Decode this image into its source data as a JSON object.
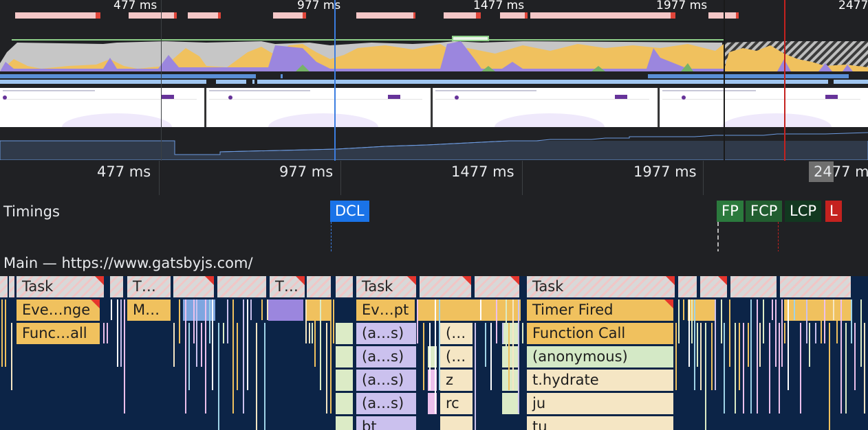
{
  "overview": {
    "time_labels": [
      "477 ms",
      "977 ms",
      "1477 ms",
      "1977 ms",
      "2477"
    ]
  },
  "ruler": {
    "time_labels": [
      "477 ms",
      "977 ms",
      "1477 ms",
      "1977 ms",
      "2477 m"
    ]
  },
  "timings": {
    "title": "Timings",
    "markers": [
      {
        "label": "DCL",
        "color": "#1a73e8"
      },
      {
        "label": "FP",
        "color": "#1e8e3e"
      },
      {
        "label": "FCP",
        "color": "#1e6b33"
      },
      {
        "label": "LCP",
        "color": "#0d3b1e"
      },
      {
        "label": "L",
        "color": "#c5221f"
      }
    ]
  },
  "main": {
    "title": "Main — https://www.gatsbyjs.com/",
    "blocks": {
      "task1": "Task",
      "task2": "T…",
      "task3": "T…",
      "task4": "Task",
      "task5": "Task",
      "event1": "Eve…nge",
      "misc1": "M…",
      "event2": "Ev…pt",
      "timer": "Timer Fired",
      "func1": "Func…all",
      "anon1": "(a…s)",
      "paren1": "(…",
      "funccall": "Function Call",
      "anon2": "(a…s)",
      "paren2": "(…",
      "anonymous": "(anonymous)",
      "anon3": "(a…s)",
      "z": "z",
      "hydrate": "t.hydrate",
      "anon4": "(a…s)",
      "rc": "rc",
      "ju": "ju",
      "bt": "bt",
      "tu": "tu"
    }
  },
  "colors": {
    "scripting": "#f0c15e",
    "rendering": "#9b86de",
    "painting": "#76b367",
    "idle_gray": "#c6c6c6",
    "long_task_red": "#e5352d",
    "flame_bg": "#0c2447"
  }
}
